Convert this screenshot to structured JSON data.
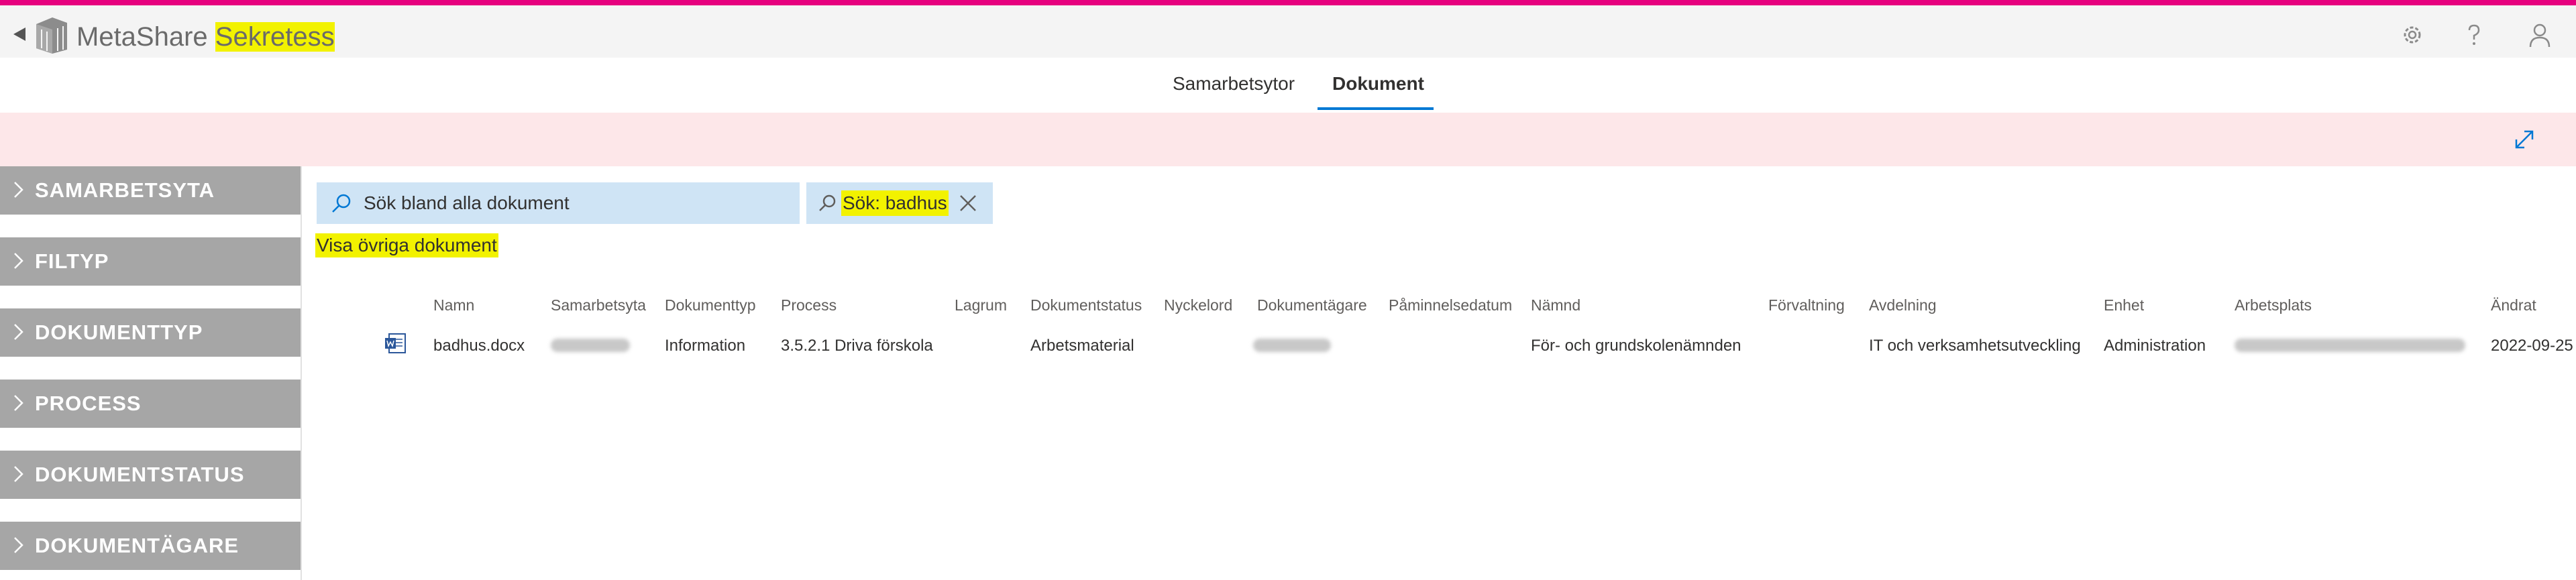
{
  "header": {
    "app_name": "MetaShare",
    "app_suffix": "Sekretess",
    "icons": [
      "back-arrow-icon",
      "metashare-logo",
      "settings-icon",
      "help-icon",
      "user-icon"
    ]
  },
  "tabs": [
    {
      "label": "Samarbetsytor",
      "active": false
    },
    {
      "label": "Dokument",
      "active": true
    }
  ],
  "sidebar": {
    "items": [
      {
        "label": "SAMARBETSYTA"
      },
      {
        "label": "FILTYP"
      },
      {
        "label": "DOKUMENTTYP"
      },
      {
        "label": "PROCESS"
      },
      {
        "label": "DOKUMENTSTATUS"
      },
      {
        "label": "DOKUMENTÄGARE"
      }
    ]
  },
  "search": {
    "placeholder": "Sök bland alla dokument",
    "value": "",
    "active_filter": "Sök: badhus"
  },
  "other_docs_link": "Visa övriga dokument",
  "table": {
    "columns": [
      "Namn",
      "Samarbetsyta",
      "Dokumenttyp",
      "Process",
      "Lagrum",
      "Dokumentstatus",
      "Nyckelord",
      "Dokumentägare",
      "Påminnelsedatum",
      "Nämnd",
      "Förvaltning",
      "Avdelning",
      "Enhet",
      "Arbetsplats",
      "Ändrat"
    ],
    "rows": [
      {
        "name": "badhus.docx",
        "doc_type": "Information",
        "process": "3.5.2.1 Driva förskola",
        "status": "Arbetsmaterial",
        "namnd": "För- och grundskolenämnden",
        "avdelning": "IT och verksamhetsutveckling",
        "enhet": "Administration",
        "andrat": "2022-09-25"
      }
    ]
  },
  "colors": {
    "accent": "#e6007e",
    "highlight": "#f2f200",
    "banner": "#fde7e9",
    "search_bg": "#cfe4f5",
    "sidebar_item": "#a6a6a6",
    "tab_underline": "#0078d4"
  }
}
